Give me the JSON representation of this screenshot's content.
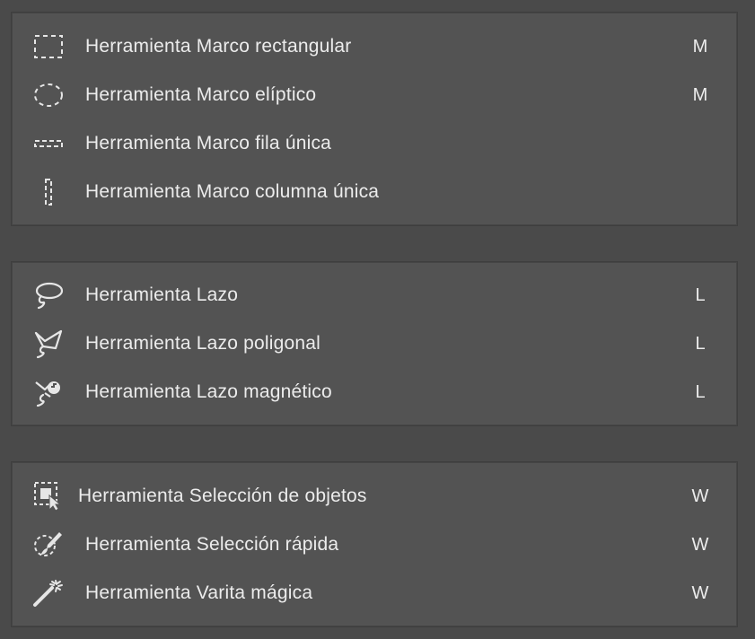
{
  "groups": {
    "marquee": {
      "items": [
        {
          "label": "Herramienta Marco rectangular",
          "shortcut": "M",
          "icon": "rectangular-marquee-icon"
        },
        {
          "label": "Herramienta Marco elíptico",
          "shortcut": "M",
          "icon": "elliptical-marquee-icon"
        },
        {
          "label": "Herramienta Marco fila única",
          "shortcut": "",
          "icon": "single-row-marquee-icon"
        },
        {
          "label": "Herramienta Marco columna única",
          "shortcut": "",
          "icon": "single-column-marquee-icon"
        }
      ]
    },
    "lasso": {
      "items": [
        {
          "label": "Herramienta Lazo",
          "shortcut": "L",
          "icon": "lasso-icon"
        },
        {
          "label": "Herramienta Lazo poligonal",
          "shortcut": "L",
          "icon": "polygonal-lasso-icon"
        },
        {
          "label": "Herramienta Lazo magnético",
          "shortcut": "L",
          "icon": "magnetic-lasso-icon"
        }
      ]
    },
    "selection": {
      "items": [
        {
          "label": "Herramienta Selección de objetos",
          "shortcut": "W",
          "icon": "object-selection-icon"
        },
        {
          "label": "Herramienta Selección rápida",
          "shortcut": "W",
          "icon": "quick-selection-icon"
        },
        {
          "label": "Herramienta Varita mágica",
          "shortcut": "W",
          "icon": "magic-wand-icon"
        }
      ]
    }
  },
  "colors": {
    "background": "#4a4a4a",
    "panel": "#535353",
    "text": "#ececec"
  }
}
